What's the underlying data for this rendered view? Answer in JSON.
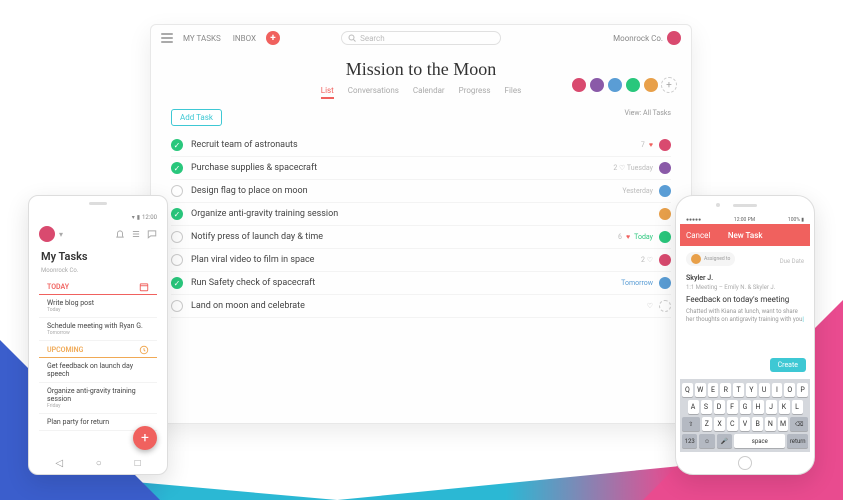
{
  "desktop": {
    "nav": {
      "myTasks": "MY TASKS",
      "inbox": "INBOX"
    },
    "search_placeholder": "Search",
    "workspace": "Moonrock Co.",
    "title": "Mission to the Moon",
    "tabs": [
      "List",
      "Conversations",
      "Calendar",
      "Progress",
      "Files"
    ],
    "active_tab": "List",
    "add_task": "Add Task",
    "view_label": "View: All Tasks",
    "tasks": [
      {
        "done": true,
        "name": "Recruit team of astronauts",
        "meta": "7 ♥",
        "assignee": "#d94a6f"
      },
      {
        "done": true,
        "name": "Purchase supplies & spacecraft",
        "meta": "2 ♡  Tuesday",
        "assignee": "#8a5aa8"
      },
      {
        "done": false,
        "name": "Design flag to place on moon",
        "meta": "Yesterday",
        "assignee": "#5a9dd5"
      },
      {
        "done": true,
        "name": "Organize anti-gravity training session",
        "meta": "",
        "assignee": "#e8a04a"
      },
      {
        "done": false,
        "name": "Notify press of launch day & time",
        "meta": "6 ♥  Today",
        "today": true,
        "assignee": "#29c77c"
      },
      {
        "done": false,
        "name": "Plan viral video to film in space",
        "meta": "2 ♡",
        "assignee": "#d94a6f"
      },
      {
        "done": true,
        "name": "Run Safety check of spacecraft",
        "meta": "Tomorrow",
        "tomorrow": true,
        "assignee": "#5a9dd5"
      },
      {
        "done": false,
        "name": "Land on moon and celebrate",
        "meta": "♡",
        "assignee": ""
      }
    ],
    "members": [
      "#d94a6f",
      "#8a5aa8",
      "#5a9dd5",
      "#29c77c",
      "#e8a04a"
    ]
  },
  "android": {
    "title": "My Tasks",
    "subtitle": "Moonrock Co.",
    "today_label": "TODAY",
    "upcoming_label": "UPCOMING",
    "today": [
      {
        "name": "Write blog post",
        "sub": "Today"
      },
      {
        "name": "Schedule meeting with Ryan G.",
        "sub": "Tomorrow"
      }
    ],
    "upcoming": [
      {
        "name": "Get feedback on launch day speech",
        "sub": ""
      },
      {
        "name": "Organize anti-gravity training session",
        "sub": "Friday"
      },
      {
        "name": "Plan party for return",
        "sub": ""
      }
    ]
  },
  "iphone": {
    "status_time": "12:00 PM",
    "cancel": "Cancel",
    "header": "New Task",
    "assignee": "Skyler J.",
    "due": "Due Date",
    "project": "1:1 Meeting – Emily N. & Skyler J.",
    "task_title": "Feedback on today's meeting",
    "note": "Chatted with Kiana at lunch, want to share her thoughts on antigravity training with you",
    "create": "Create",
    "keys_r1": [
      "Q",
      "W",
      "E",
      "R",
      "T",
      "Y",
      "U",
      "I",
      "O",
      "P"
    ],
    "keys_r2": [
      "A",
      "S",
      "D",
      "F",
      "G",
      "H",
      "J",
      "K",
      "L"
    ],
    "keys_r3": [
      "Z",
      "X",
      "C",
      "V",
      "B",
      "N",
      "M"
    ],
    "space": "space",
    "return": "return"
  }
}
